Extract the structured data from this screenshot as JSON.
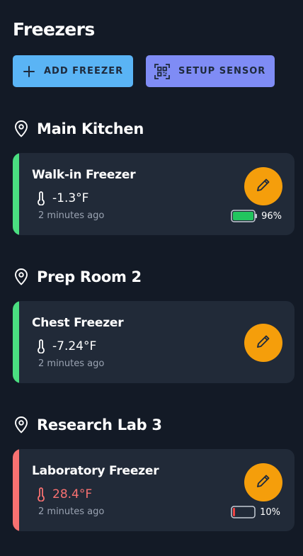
{
  "page": {
    "title": "Freezers"
  },
  "actions": {
    "add_label": "ADD FREEZER",
    "setup_label": "SETUP SENSOR",
    "add_color": "#5ab4f5",
    "setup_color": "#7f8cf5"
  },
  "colors": {
    "background": "#131a26",
    "card": "#212a38",
    "ok": "#4ade80",
    "alert": "#f87171",
    "edit_button": "#f59e0b"
  },
  "locations": [
    {
      "name": "Main Kitchen",
      "icon": "map-pin-icon",
      "freezers": [
        {
          "name": "Walk-in Freezer",
          "temperature": "-1.3°F",
          "updated": "2 minutes ago",
          "status": "ok",
          "battery": "96%",
          "battery_level": 0.96
        }
      ]
    },
    {
      "name": "Prep Room 2",
      "icon": "map-pin-icon",
      "freezers": [
        {
          "name": "Chest Freezer",
          "temperature": "-7.24°F",
          "updated": "2 minutes ago",
          "status": "ok"
        }
      ]
    },
    {
      "name": "Research Lab 3",
      "icon": "map-pin-icon",
      "freezers": [
        {
          "name": "Laboratory Freezer",
          "temperature": "28.4°F",
          "updated": "2 minutes ago",
          "status": "alert",
          "battery": "10%",
          "battery_level": 0.1
        }
      ]
    }
  ]
}
